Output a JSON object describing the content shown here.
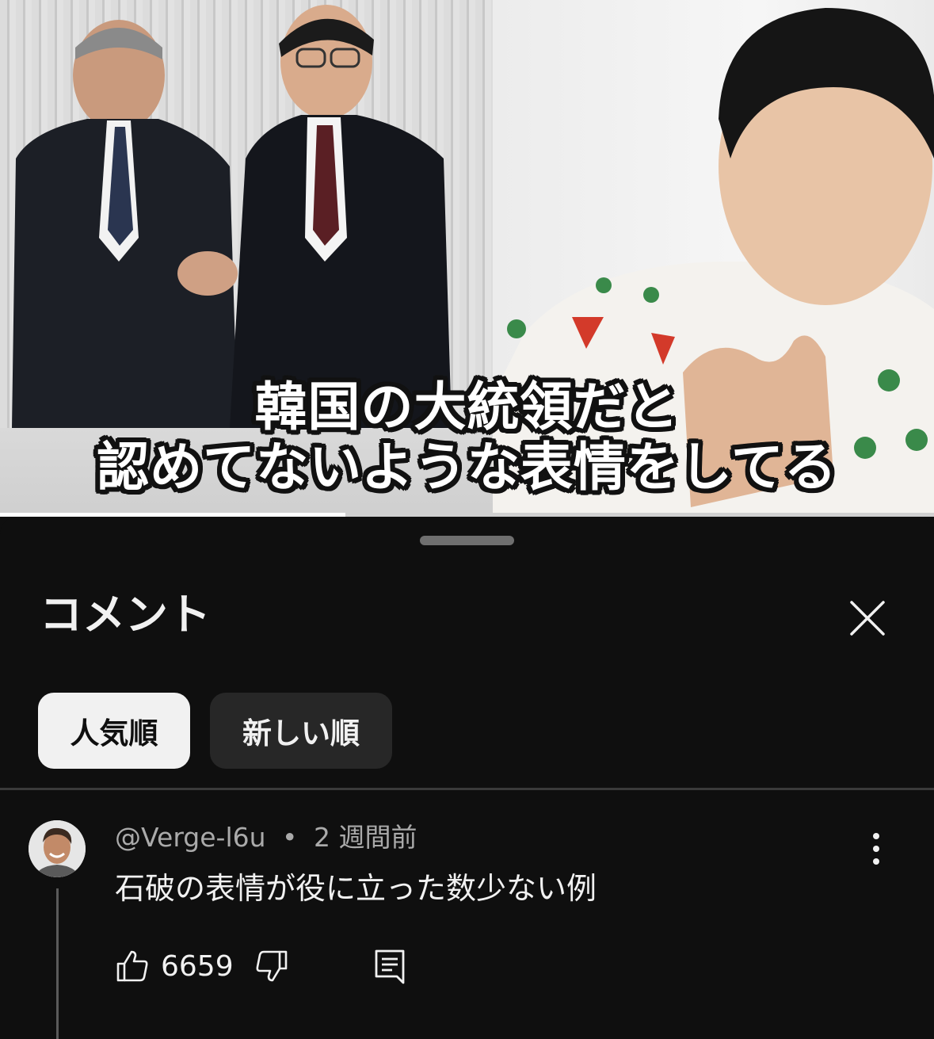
{
  "video": {
    "caption_line1": "韓国の大統領だと",
    "caption_line2": "認めてないような表情をしてる",
    "progress": 0.37
  },
  "comments_panel": {
    "title": "コメント",
    "sort_chips": [
      {
        "label": "人気順",
        "active": true
      },
      {
        "label": "新しい順",
        "active": false
      }
    ]
  },
  "comment": {
    "author": "@Verge-l6u",
    "separator": "•",
    "time": "2 週間前",
    "text": "石破の表情が役に立った数少ない例",
    "likes": "6659"
  },
  "icons": {
    "close": "close-icon",
    "more": "more-vert-icon",
    "like": "thumb-up-icon",
    "dislike": "thumb-down-icon",
    "reply": "reply-comment-icon"
  },
  "colors": {
    "background": "#0f0f0f",
    "text_primary": "#f1f1f1",
    "text_secondary": "#aaaaaa",
    "chip_inactive": "#272727"
  }
}
